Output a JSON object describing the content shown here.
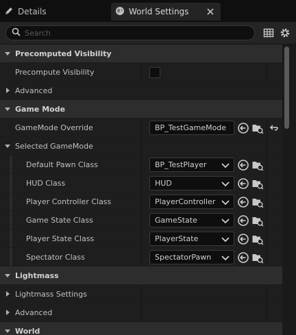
{
  "tabs": [
    {
      "label": "Details",
      "icon": "pencil-icon"
    },
    {
      "label": "World Settings",
      "icon": "globe-icon"
    }
  ],
  "search": {
    "placeholder": "Search",
    "value": ""
  },
  "rows": [
    {
      "kind": "category",
      "label": "Precomputed Visibility",
      "expanded": true
    },
    {
      "kind": "prop",
      "label": "Precompute Visibility",
      "checkbox": false
    },
    {
      "kind": "group",
      "label": "Advanced",
      "expanded": false
    },
    {
      "kind": "category",
      "label": "Game Mode",
      "expanded": true
    },
    {
      "kind": "prop",
      "label": "GameMode Override",
      "value": "BP_TestGameMode",
      "reset": true
    },
    {
      "kind": "group",
      "label": "Selected GameMode",
      "expanded": true
    },
    {
      "kind": "sub",
      "label": "Default Pawn Class",
      "value": "BP_TestPlayer"
    },
    {
      "kind": "sub",
      "label": "HUD Class",
      "value": "HUD"
    },
    {
      "kind": "sub",
      "label": "Player Controller Class",
      "value": "PlayerController"
    },
    {
      "kind": "sub",
      "label": "Game State Class",
      "value": "GameState"
    },
    {
      "kind": "sub",
      "label": "Player State Class",
      "value": "PlayerState"
    },
    {
      "kind": "sub",
      "label": "Spectator Class",
      "value": "SpectatorPawn"
    },
    {
      "kind": "category",
      "label": "Lightmass",
      "expanded": true
    },
    {
      "kind": "group",
      "label": "Lightmass Settings",
      "expanded": false
    },
    {
      "kind": "group",
      "label": "Advanced",
      "expanded": false
    },
    {
      "kind": "category",
      "label": "World",
      "expanded": true
    }
  ],
  "colors": {
    "accent": "#2d2d2d",
    "panel": "#1e1e1e",
    "text": "#c0c0c0"
  }
}
